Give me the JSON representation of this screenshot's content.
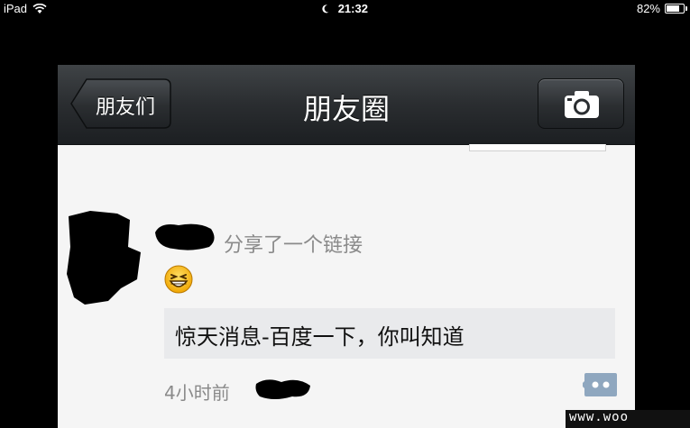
{
  "status_bar": {
    "device": "iPad",
    "time": "21:32",
    "battery": "82%",
    "battery_level": 0.82
  },
  "navbar": {
    "back_label": "朋友们",
    "title": "朋友圈",
    "camera_icon": "camera-icon"
  },
  "post": {
    "action_text": "分享了一个链接",
    "emoji": "grinning-face",
    "link_title": "惊天消息-百度一下，你叫知道",
    "time_ago": "4小时前",
    "comment_icon": "comment-bubble-icon"
  },
  "colors": {
    "navbar": "#2a2d30",
    "background": "#f5f5f5",
    "link_card": "#e9eaec",
    "secondary_text": "#8a8a8a",
    "comment_icon": "#8fa7bf"
  },
  "watermark": "www.woo"
}
